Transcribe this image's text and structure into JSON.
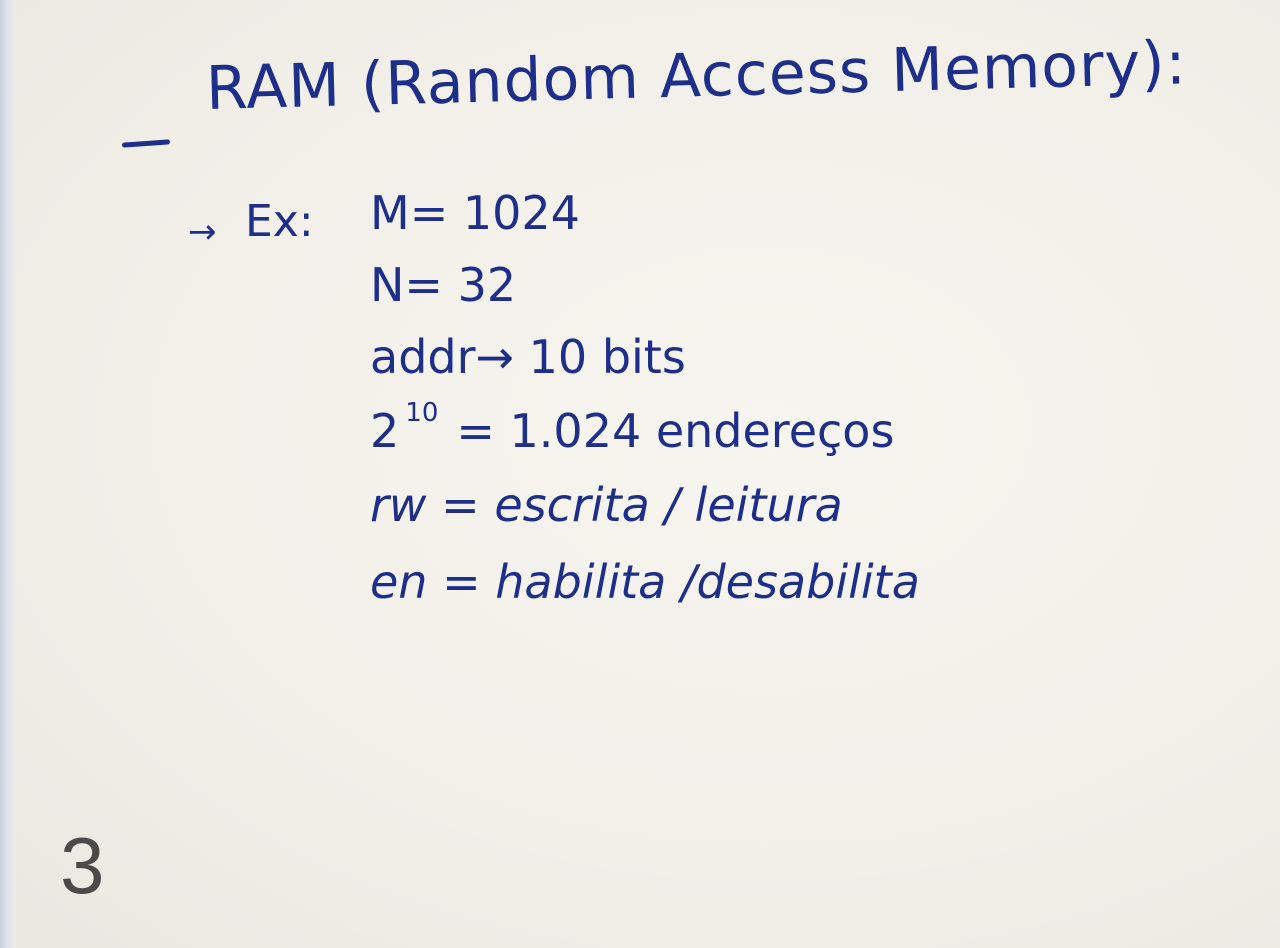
{
  "notes": {
    "title": "RAM (Random Access Memory):",
    "example_arrow": "→",
    "example_label": "Ex:",
    "lines": [
      {
        "text": "M= 1024"
      },
      {
        "text": "N= 32"
      },
      {
        "text": "addr→ 10 bits"
      },
      {
        "base": "2",
        "exponent": "10",
        "rest": "= 1.024 endereços"
      },
      {
        "text": "rw = escrita / leitura"
      },
      {
        "text": "en = habilita /desabilita"
      }
    ]
  },
  "page_number": "3"
}
